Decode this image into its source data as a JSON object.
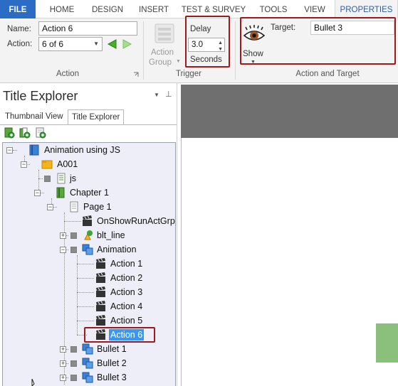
{
  "tabs": [
    "FILE",
    "HOME",
    "DESIGN",
    "INSERT",
    "TEST & SURVEY",
    "TOOLS",
    "VIEW",
    "PROPERTIES"
  ],
  "action_group": {
    "name_label": "Name:",
    "name_value": "Action 6",
    "action_label": "Action:",
    "action_value": "6 of 6",
    "group_label": "Action",
    "action_group_btn": "Action",
    "action_group_btn2": "Group"
  },
  "trigger_group": {
    "delay_label": "Delay",
    "delay_value": "3.0",
    "seconds_label": "Seconds",
    "group_label": "Trigger"
  },
  "action_target_group": {
    "show_label": "Show",
    "target_label": "Target:",
    "target_value": "Bullet 3",
    "group_label": "Action and Target"
  },
  "explorer": {
    "title": "Title Explorer",
    "tab_thumbnail": "Thumbnail View",
    "tab_explorer": "Title Explorer"
  },
  "tree": [
    "Animation using JS",
    "A001",
    "js",
    "Chapter 1",
    "Page 1",
    "OnShowRunActGrp",
    "blt_line",
    "Animation",
    "Action 1",
    "Action 2",
    "Action 3",
    "Action 4",
    "Action 5",
    "Action 6",
    "Bullet 1",
    "Bullet 2",
    "Bullet 3"
  ],
  "colors": {
    "file_tab": "#2b6cc4",
    "highlight_box": "#a01818",
    "selection": "#3399ff",
    "canvas_header": "#6f6f6f",
    "green_shape": "#8bc07c"
  }
}
